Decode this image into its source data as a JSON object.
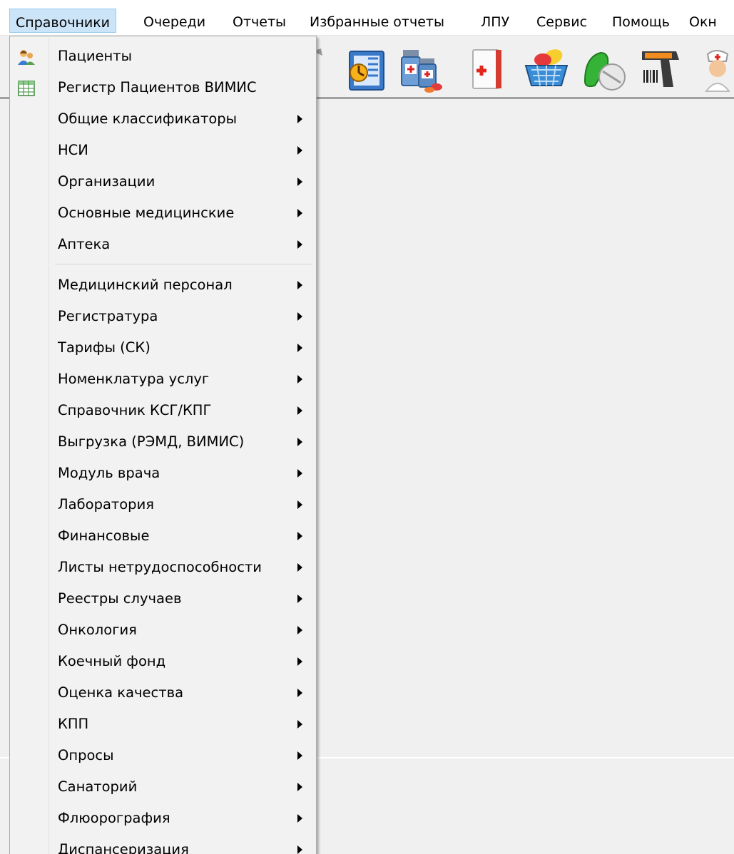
{
  "menubar": {
    "items": [
      "Справочники",
      "Очереди",
      "Отчеты",
      "Избранные отчеты",
      "ЛПУ",
      "Сервис",
      "Помощь",
      "Окн"
    ]
  },
  "toolbar": {
    "icons": [
      "toolbar-icon-partial-left",
      "dashboard-report-icon",
      "medicine-bottles-icon",
      "medical-book-icon",
      "pharmacy-basket-icon",
      "pills-icon",
      "barcode-scanner-icon",
      "nurse-icon"
    ]
  },
  "menu": {
    "items": [
      {
        "label": "Пациенты",
        "icon": "patients-icon"
      },
      {
        "label": "Регистр Пациентов ВИМИС",
        "icon": "table-grid-icon"
      },
      {
        "label": "Общие классификаторы"
      },
      {
        "label": "НСИ"
      },
      {
        "label": "Организации"
      },
      {
        "label": "Основные медицинские"
      },
      {
        "label": "Аптека"
      },
      {
        "label": "Медицинский персонал"
      },
      {
        "label": "Регистратура"
      },
      {
        "label": "Тарифы (СК)"
      },
      {
        "label": "Номенклатура услуг"
      },
      {
        "label": "Справочник КСГ/КПГ"
      },
      {
        "label": "Выгрузка (РЭМД, ВИМИС)"
      },
      {
        "label": "Модуль врача"
      },
      {
        "label": "Лаборатория"
      },
      {
        "label": "Финансовые"
      },
      {
        "label": "Листы нетрудоспособности"
      },
      {
        "label": "Реестры случаев"
      },
      {
        "label": "Онкология"
      },
      {
        "label": "Коечный фонд"
      },
      {
        "label": "Оценка качества"
      },
      {
        "label": "КПП"
      },
      {
        "label": "Опросы"
      },
      {
        "label": "Санаторий"
      },
      {
        "label": "Флюорография"
      },
      {
        "label": "Диспансеризация"
      }
    ]
  }
}
